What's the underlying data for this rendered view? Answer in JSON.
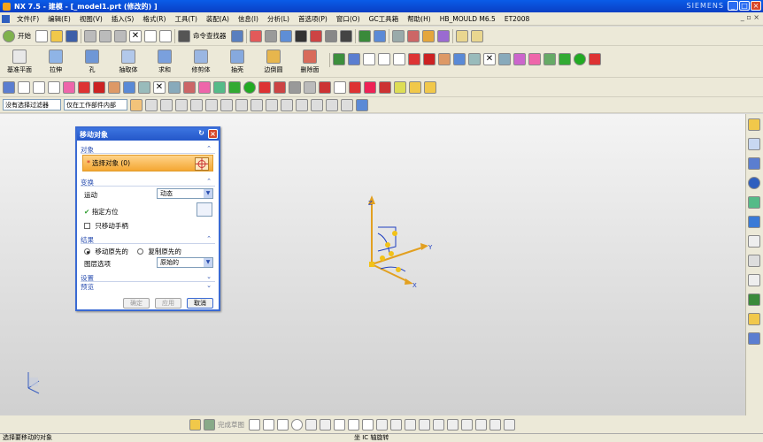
{
  "window": {
    "title": "NX 7.5 - 建模 - [_model1.prt (修改的) ]",
    "brand": "SIEMENS"
  },
  "menu": {
    "items": [
      "文件(F)",
      "编辑(E)",
      "视图(V)",
      "插入(S)",
      "格式(R)",
      "工具(T)",
      "装配(A)",
      "信息(I)",
      "分析(L)",
      "首选项(P)",
      "窗口(O)",
      "GC工具箱",
      "帮助(H)",
      "HB_MOULD M6.5",
      "ET2008"
    ]
  },
  "toolbar1": {
    "start": "开始",
    "command_finder": "命令查找器"
  },
  "toolbar2": {
    "items": [
      "基准平面",
      "拉伸",
      "孔",
      "抽取体",
      "求和",
      "修剪体",
      "抽壳",
      "边倒圆",
      "删除面"
    ]
  },
  "toolbar4": {
    "filter": "没有选择过滤器",
    "scope": "仅在工作部件内部"
  },
  "dialog": {
    "title": "移动对象",
    "objects_group": "对象",
    "select_objects": "选择对象 (0)",
    "transform_group": "变换",
    "motion_label": "运动",
    "motion_value": "动态",
    "specify_orientation": "指定方位",
    "move_handles_only": "只移动手柄",
    "result_group": "结果",
    "move_original": "移动原先的",
    "copy_original": "复制原先的",
    "layer_label": "图层选项",
    "layer_value": "原始的",
    "settings_group": "设置",
    "preview_group": "预览",
    "ok": "确定",
    "apply": "应用",
    "cancel": "取消"
  },
  "bottom_toolbar": {
    "finish_sketch": "完成草图"
  },
  "status": {
    "left": "选择要移动的对象",
    "right": "坐 IC 轴旋转"
  }
}
